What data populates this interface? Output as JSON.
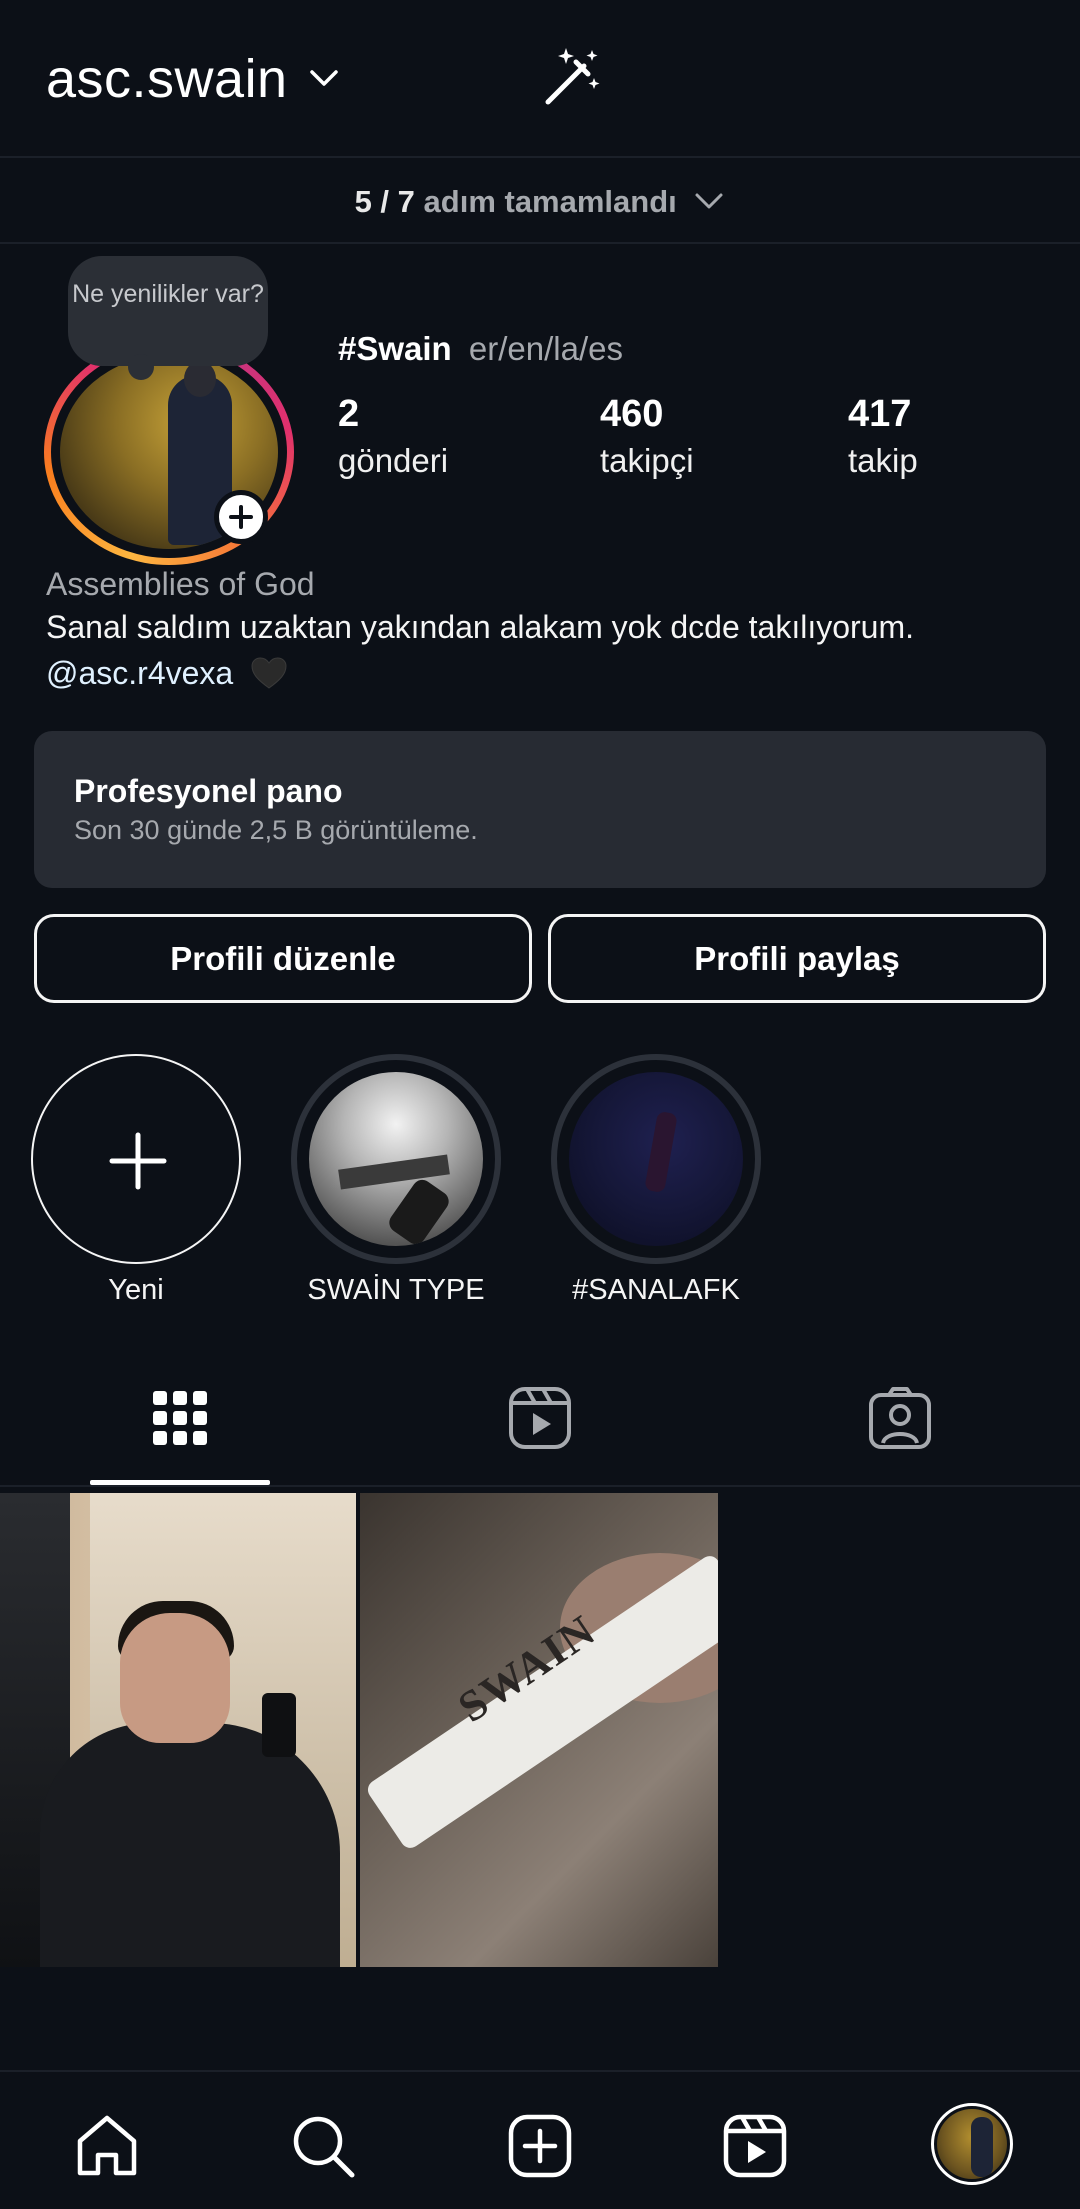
{
  "header": {
    "username": "asc.swain",
    "steps_count": "5 / 7",
    "steps_text": "adım tamamlandı"
  },
  "note": {
    "text": "Ne yenilikler var?"
  },
  "profile": {
    "display_name": "#Swain",
    "pronouns": "er/en/la/es",
    "stats": [
      {
        "value": "2",
        "label": "gönderi"
      },
      {
        "value": "460",
        "label": "takipçi"
      },
      {
        "value": "417",
        "label": "takip"
      }
    ],
    "category": "Assemblies of God",
    "bio": "Sanal saldım uzaktan yakından alakam yok dcde takılıyorum.",
    "mention": "@asc.r4vexa"
  },
  "pro_dashboard": {
    "title": "Profesyonel pano",
    "subtitle": "Son 30 günde 2,5 B görüntüleme."
  },
  "buttons": {
    "edit_profile": "Profili düzenle",
    "share_profile": "Profili paylaş"
  },
  "highlights": [
    {
      "label": "Yeni"
    },
    {
      "label": "SWAİN TYPE"
    },
    {
      "label": "#SANALAFK"
    }
  ],
  "tabs": {
    "active": "grid"
  },
  "posts": [
    {
      "image": "mirror-selfie-neck-tattoo"
    },
    {
      "image": "cigarette-swain"
    }
  ],
  "post_overlay_text": "SWAIN",
  "colors": {
    "background": "#0c1017",
    "card": "#272b33",
    "secondary_text": "#a6a9ae",
    "mention": "#e0f1ff",
    "story_ring": "#e1306c"
  }
}
